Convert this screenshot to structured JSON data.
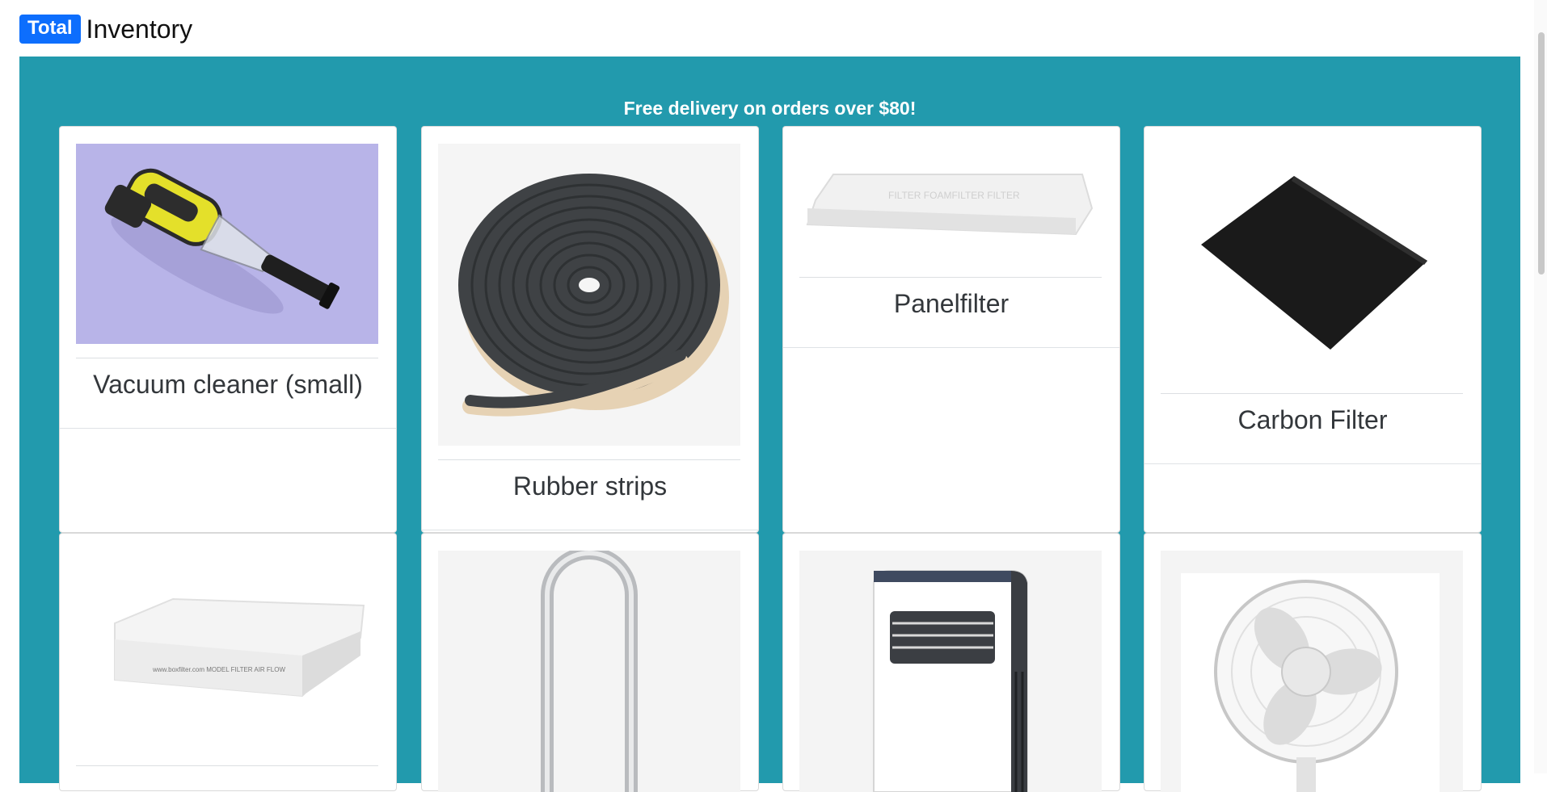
{
  "header": {
    "badge": "Total",
    "title": "Inventory"
  },
  "promo": "Free delivery on orders over $80!",
  "products": [
    {
      "name": "Vacuum cleaner (small)",
      "image": "handheld-vacuum-image"
    },
    {
      "name": "Rubber strips",
      "image": "rubber-strip-roll-image"
    },
    {
      "name": "Panelfilter",
      "image": "panel-filter-image"
    },
    {
      "name": "Carbon Filter",
      "image": "carbon-filter-image"
    },
    {
      "name": "",
      "image": "box-filter-image"
    },
    {
      "name": "",
      "image": "tower-fan-image"
    },
    {
      "name": "",
      "image": "portable-air-conditioner-image"
    },
    {
      "name": "",
      "image": "desk-fan-image"
    }
  ],
  "colors": {
    "badge": "#0d6efd",
    "panel": "#229aad",
    "card": "#ffffff",
    "vacuum_bg": "#b8b4e8"
  }
}
